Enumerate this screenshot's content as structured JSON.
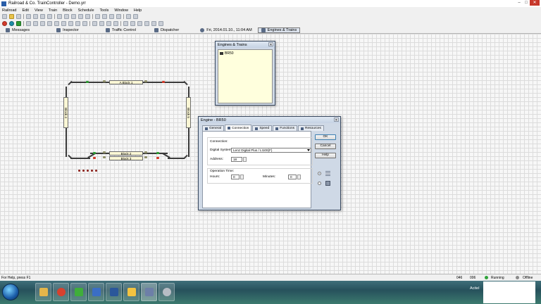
{
  "window": {
    "title": "Railroad & Co. TrainController - Demo.yrr",
    "controls": [
      "–",
      "□",
      "✕"
    ]
  },
  "menu": [
    "Railroad",
    "Edit",
    "View",
    "Train",
    "Block",
    "Schedule",
    "Tools",
    "Window",
    "Help"
  ],
  "palette_bar": {
    "messages": "Messages",
    "inspector": "Inspector",
    "traffic_control": "Traffic Control",
    "dispatcher": "Dispatcher",
    "datetime": "Fri, 2014.01.10., 11:04 AM",
    "engines_trains": "Engines & Trains"
  },
  "layout": {
    "block_top": "A Block 1",
    "block_left": "Block 4",
    "block_right": "Block 5",
    "block_bottom_1": "Block 2",
    "block_bottom_2": "Block 3"
  },
  "engines_panel": {
    "title": "Engines & Trains",
    "close": "✕",
    "items": [
      "BR50"
    ]
  },
  "engine_dialog": {
    "title": "Engine - BR50",
    "close": "✕",
    "tabs": [
      "General",
      "Connection",
      "Speed",
      "Functions",
      "Resources"
    ],
    "active_tab": "Connection",
    "connection_label": "Connection:",
    "digital_system_label": "Digital System:",
    "digital_system_value": "Lenz Digital Plus / LI100(F)",
    "address_label": "Address:",
    "address_value": "18",
    "operation_time_label": "Operation Time:",
    "hours_label": "Hours:",
    "hours_value": "0",
    "minutes_label": "Minutes:",
    "minutes_value": "0",
    "buttons": {
      "ok": "OK",
      "cancel": "Cancel",
      "help": "Help"
    }
  },
  "status": {
    "help": "For Help, press F1",
    "counter_1": "046",
    "counter_2": "006",
    "running": "Running",
    "offline": "Offline"
  },
  "taskbar": {
    "tray_label": "Acitel"
  },
  "colors": {
    "dialog_frame": "#cfd9e6",
    "block_fill": "#fbf7d5",
    "engine_list_bg": "#ffffdd",
    "running_green": "#2fa33a",
    "signal_red": "#d23a2a"
  }
}
